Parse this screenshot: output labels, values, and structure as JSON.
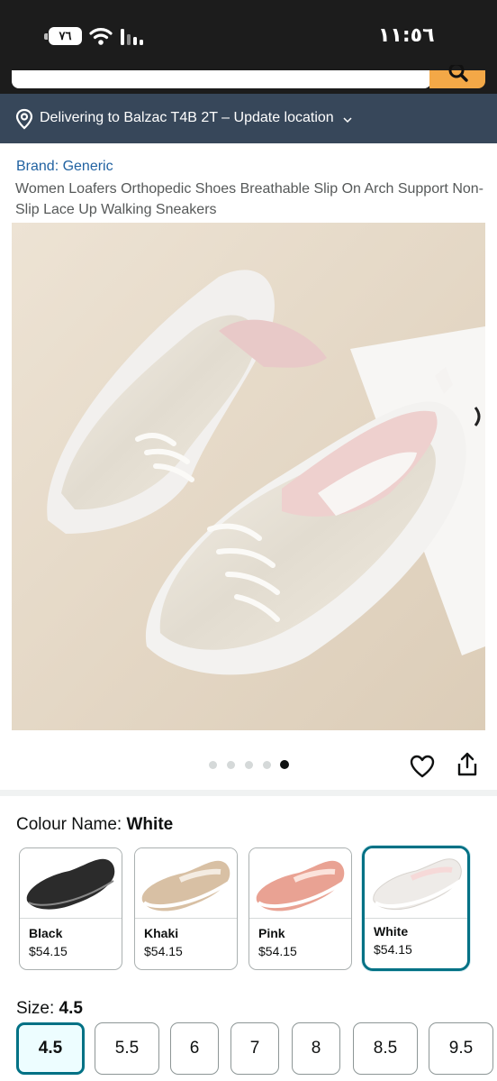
{
  "status_bar": {
    "battery": "٧٦",
    "time": "١١:٥٦"
  },
  "delivery": {
    "text": "Delivering to Balzac T4B 2T – Update location"
  },
  "product": {
    "brand": "Brand: Generic",
    "title": "Women Loafers Orthopedic Shoes Breathable Slip On Arch Support Non-Slip Lace Up Walking Sneakers"
  },
  "carousel": {
    "count": 5,
    "active_index": 4
  },
  "colour": {
    "label": "Colour Name: ",
    "selected": "White",
    "options": [
      {
        "name": "Black",
        "price": "$54.15",
        "color": "#2b2b2b"
      },
      {
        "name": "Khaki",
        "price": "$54.15",
        "color": "#d8c0a4"
      },
      {
        "name": "Pink",
        "price": "$54.15",
        "color": "#e9a293"
      },
      {
        "name": "White",
        "price": "$54.15",
        "color": "#eeebe8"
      }
    ]
  },
  "size": {
    "label": "Size: ",
    "selected": "4.5",
    "options": [
      "4.5",
      "5.5",
      "6",
      "7",
      "8",
      "8.5",
      "9.5"
    ]
  },
  "colors": {
    "accent": "#007185",
    "header": "#1c1c1c",
    "delivery_bar": "#37475a",
    "search_button": "#f3a847",
    "link": "#2162a1"
  }
}
